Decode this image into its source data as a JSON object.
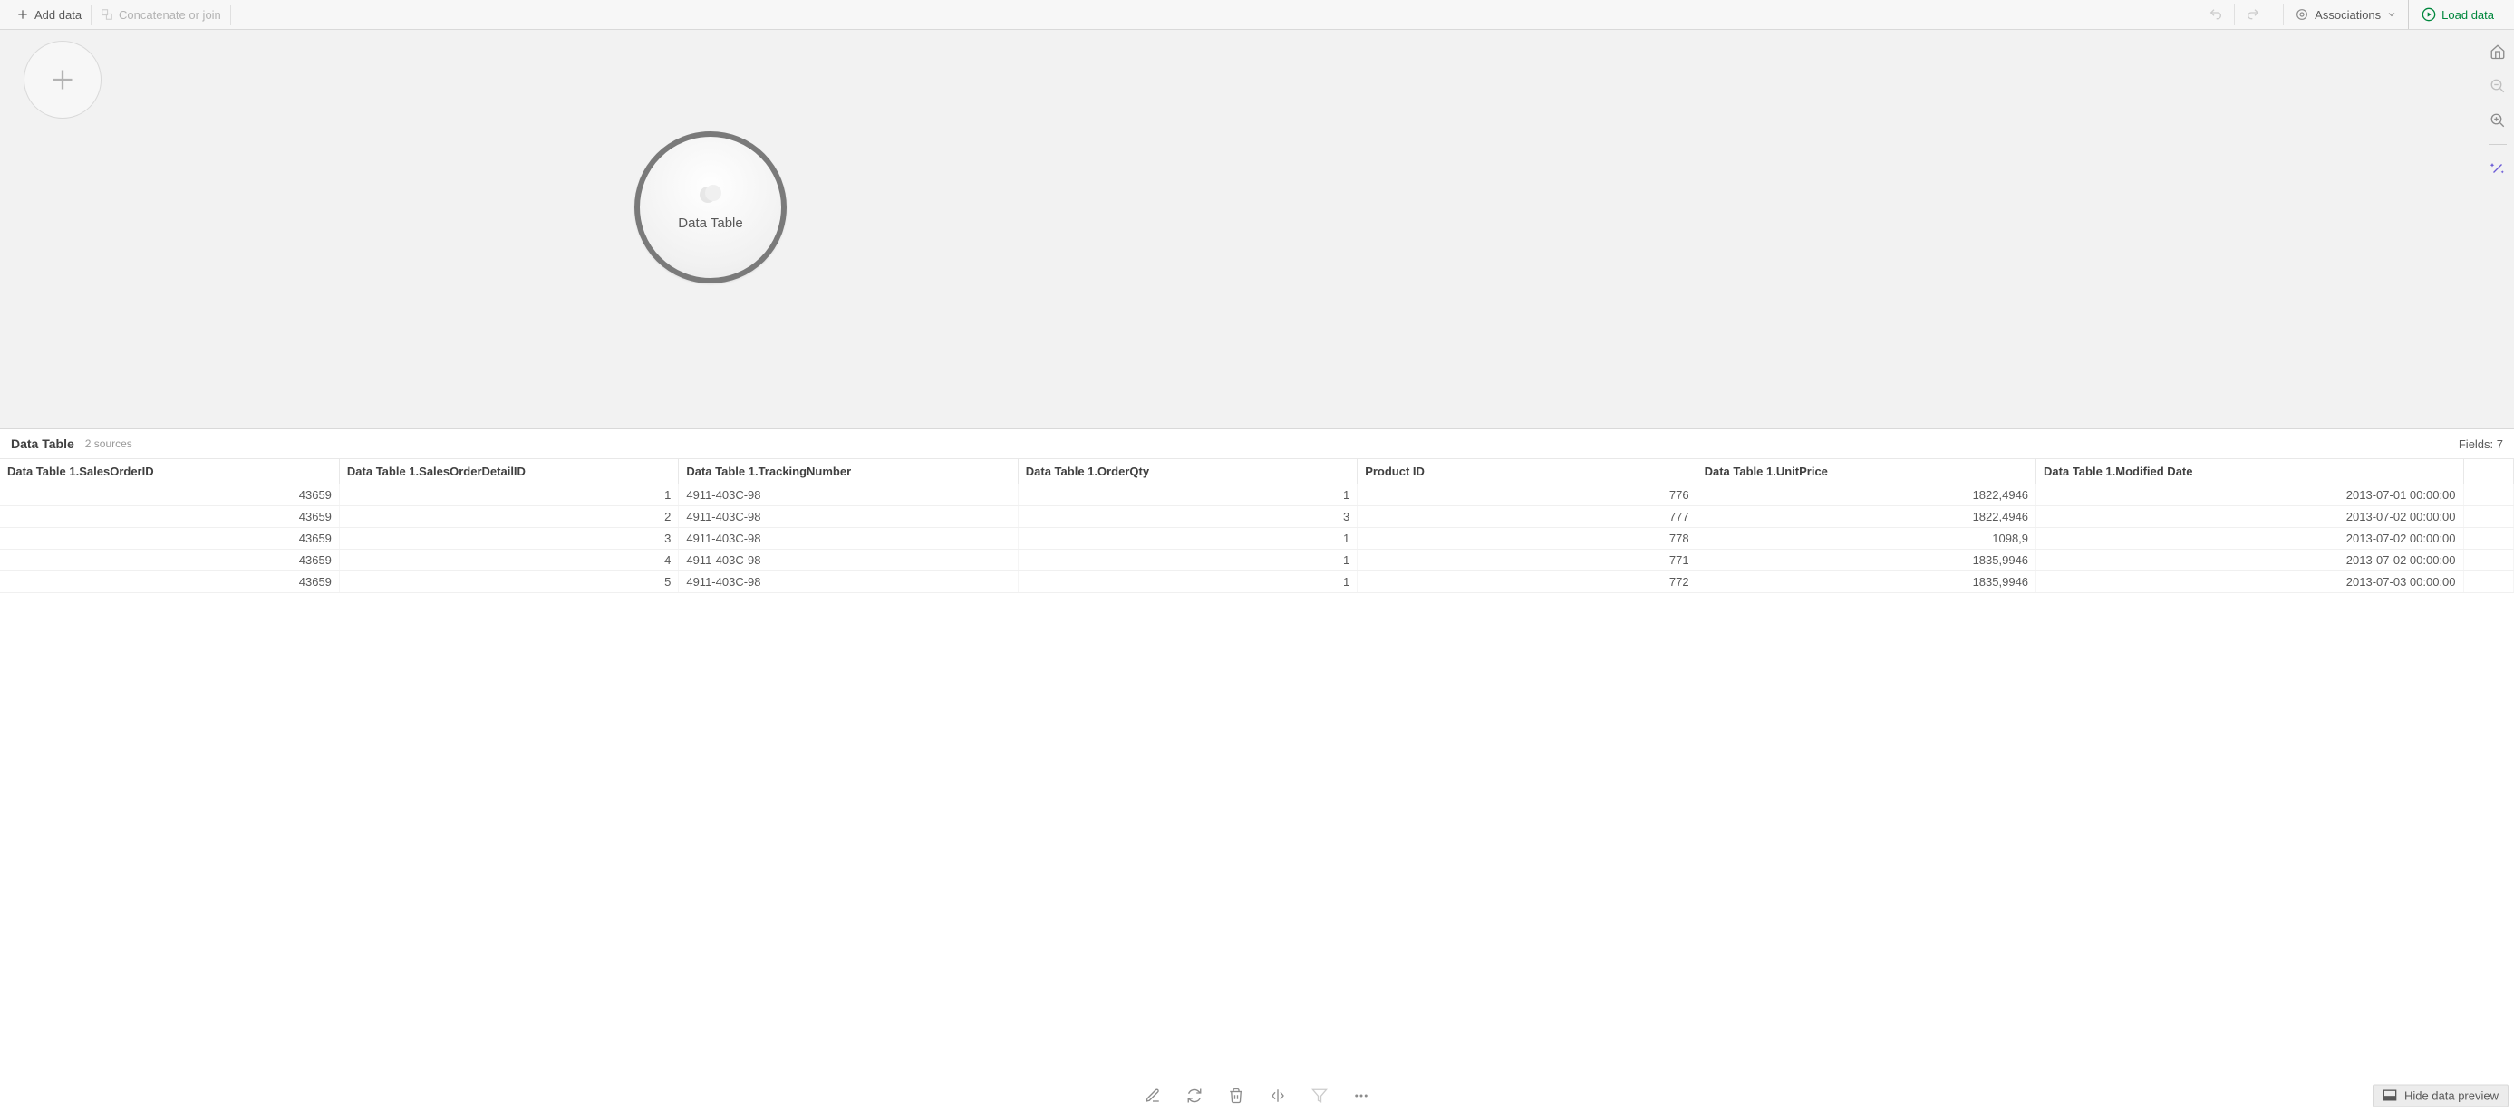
{
  "toolbar": {
    "add_data": "Add data",
    "concat_join": "Concatenate or join",
    "associations": "Associations",
    "load_data": "Load data"
  },
  "canvas": {
    "table_bubble_label": "Data Table"
  },
  "preview": {
    "title": "Data Table",
    "sources": "2 sources",
    "fields_label": "Fields: 7",
    "hide_label": "Hide data preview"
  },
  "table": {
    "columns": [
      "Data Table 1.SalesOrderID",
      "Data Table 1.SalesOrderDetailID",
      "Data Table 1.TrackingNumber",
      "Data Table 1.OrderQty",
      "Product ID",
      "Data Table 1.UnitPrice",
      "Data Table 1.Modified Date"
    ],
    "col_align": [
      "num",
      "num",
      "txt",
      "num",
      "num",
      "num",
      "num"
    ],
    "col_widths": [
      "13.5%",
      "13.5%",
      "13.5%",
      "13.5%",
      "13.5%",
      "13.5%",
      "17%",
      "2%"
    ],
    "rows": [
      [
        "43659",
        "1",
        "4911-403C-98",
        "1",
        "776",
        "1822,4946",
        "2013-07-01 00:00:00"
      ],
      [
        "43659",
        "2",
        "4911-403C-98",
        "3",
        "777",
        "1822,4946",
        "2013-07-02 00:00:00"
      ],
      [
        "43659",
        "3",
        "4911-403C-98",
        "1",
        "778",
        "1098,9",
        "2013-07-02 00:00:00"
      ],
      [
        "43659",
        "4",
        "4911-403C-98",
        "1",
        "771",
        "1835,9946",
        "2013-07-02 00:00:00"
      ],
      [
        "43659",
        "5",
        "4911-403C-98",
        "1",
        "772",
        "1835,9946",
        "2013-07-03 00:00:00"
      ]
    ]
  }
}
